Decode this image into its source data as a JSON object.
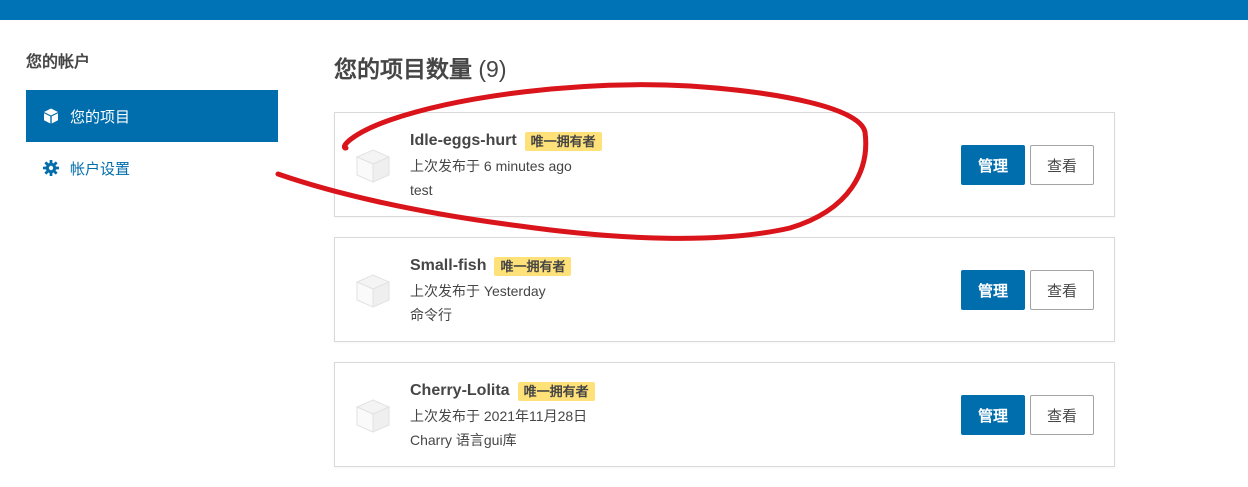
{
  "colors": {
    "brand": "#0073b7",
    "nav_active_bg": "#006dad",
    "badge_bg": "#ffe17a",
    "annotation": "#d9141a"
  },
  "sidebar": {
    "heading": "您的帐户",
    "items": [
      {
        "label": "您的项目",
        "icon": "cube-icon",
        "active": true
      },
      {
        "label": "帐户设置",
        "icon": "gear-icon",
        "active": false
      }
    ]
  },
  "main": {
    "title": "您的项目数量",
    "count": "(9)",
    "projects": [
      {
        "name": "Idle-eggs-hurt",
        "badge": "唯一拥有者",
        "published": "上次发布于 6 minutes ago",
        "description": "test",
        "manage_label": "管理",
        "view_label": "查看"
      },
      {
        "name": "Small-fish",
        "badge": "唯一拥有者",
        "published": "上次发布于 Yesterday",
        "description": "命令行",
        "manage_label": "管理",
        "view_label": "查看"
      },
      {
        "name": "Cherry-Lolita",
        "badge": "唯一拥有者",
        "published": "上次发布于 2021年11月28日",
        "description": "Charry 语言gui库",
        "manage_label": "管理",
        "view_label": "查看"
      }
    ]
  }
}
